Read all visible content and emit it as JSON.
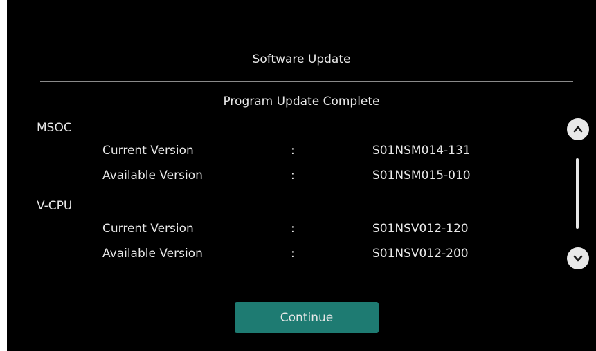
{
  "header": {
    "title": "Software Update"
  },
  "status": {
    "message": "Program Update Complete"
  },
  "sections": [
    {
      "name": "MSOC",
      "rows": [
        {
          "label": "Current Version",
          "separator": ":",
          "value": "S01NSM014-131"
        },
        {
          "label": "Available Version",
          "separator": ":",
          "value": "S01NSM015-010"
        }
      ]
    },
    {
      "name": "V-CPU",
      "rows": [
        {
          "label": "Current Version",
          "separator": ":",
          "value": "S01NSV012-120"
        },
        {
          "label": "Available Version",
          "separator": ":",
          "value": "S01NSV012-200"
        }
      ]
    }
  ],
  "scroll": {
    "up_icon": "chevron-up-icon",
    "down_icon": "chevron-down-icon"
  },
  "actions": {
    "continue_label": "Continue"
  },
  "colors": {
    "background": "#000000",
    "text": "#e8e8e8",
    "accent_button": "#1e7b72",
    "divider": "#8a8a8a"
  }
}
